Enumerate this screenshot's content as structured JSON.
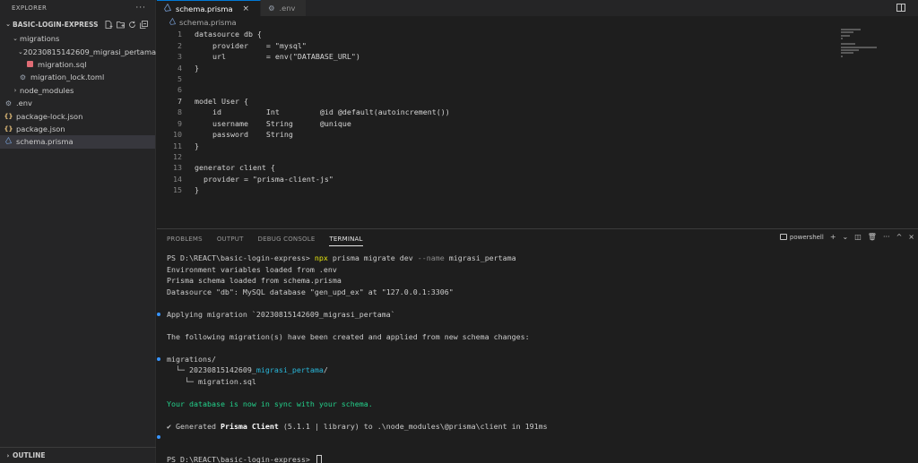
{
  "sidebar": {
    "explorer_title": "EXPLORER",
    "more_label": "···",
    "project": "BASIC-LOGIN-EXPRESS",
    "tree": [
      {
        "label": "migrations",
        "kind": "folder-open",
        "indent": 1
      },
      {
        "label": "20230815142609_migrasi_pertama",
        "kind": "folder-open",
        "indent": 2
      },
      {
        "label": "migration.sql",
        "kind": "sql",
        "indent": 3
      },
      {
        "label": "migration_lock.toml",
        "kind": "gear",
        "indent": 2
      },
      {
        "label": "node_modules",
        "kind": "folder-closed",
        "indent": 1
      },
      {
        "label": ".env",
        "kind": "gear",
        "indent": 0
      },
      {
        "label": "package-lock.json",
        "kind": "json",
        "indent": 0
      },
      {
        "label": "package.json",
        "kind": "json",
        "indent": 0
      },
      {
        "label": "schema.prisma",
        "kind": "prisma",
        "indent": 0,
        "active": true
      }
    ],
    "outline": "OUTLINE"
  },
  "tabs": [
    {
      "label": "schema.prisma",
      "active": true
    },
    {
      "label": ".env",
      "active": false
    }
  ],
  "breadcrumb": "schema.prisma",
  "code_lines": [
    "datasource db {",
    "    provider    = \"mysql\"",
    "    url         = env(\"DATABASE_URL\")",
    "}",
    "",
    "",
    "model User {",
    "    id          Int         @id @default(autoincrement())",
    "    username    String      @unique",
    "    password    String",
    "}",
    "",
    "generator client {",
    "  provider = \"prisma-client-js\"",
    "}"
  ],
  "current_line": 7,
  "panel": {
    "tabs": [
      "PROBLEMS",
      "OUTPUT",
      "DEBUG CONSOLE",
      "TERMINAL"
    ],
    "active_tab": "TERMINAL",
    "shell": "powershell"
  },
  "terminal": {
    "prompt": "PS D:\\REACT\\basic-login-express> ",
    "cmd_npx": "npx",
    "cmd_rest": " prisma migrate dev ",
    "cmd_flag": "--name",
    "cmd_arg": " migrasi_pertama",
    "env_loaded": "Environment variables loaded from .env",
    "schema_loaded": "Prisma schema loaded from schema.prisma",
    "datasource": "Datasource \"db\": MySQL database \"gen_upd_ex\" at \"127.0.0.1:3306\"",
    "applying": "Applying migration `20230815142609_migrasi_pertama`",
    "following": "The following migration(s) have been created and applied from new schema changes:",
    "migrations_dir": "migrations/",
    "tree_prefix": "  └─ 20230815142609_",
    "tree_highlight": "migrasi_pertama",
    "tree_suffix": "/",
    "sql_line": "    └─ migration.sql",
    "sync": "Your database is now in sync with your schema.",
    "gen_prefix": "✔ Generated ",
    "gen_bold": "Prisma Client",
    "gen_suffix": " (5.1.1 | library) to .\\node_modules\\@prisma\\client in 191ms",
    "final_prompt": "PS D:\\REACT\\basic-login-express> "
  }
}
